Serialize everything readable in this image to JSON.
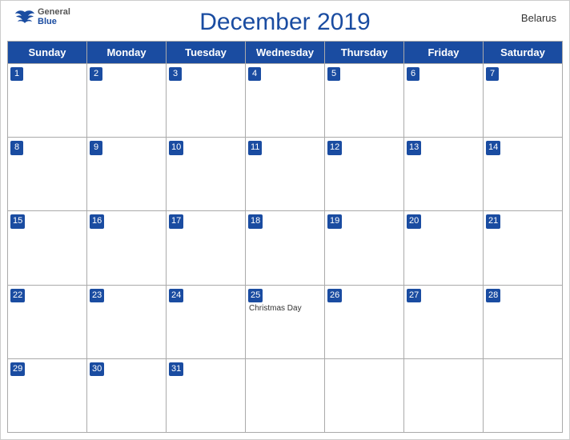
{
  "header": {
    "title": "December 2019",
    "country": "Belarus",
    "logo": {
      "line1": "General",
      "line2": "Blue"
    }
  },
  "days_of_week": [
    "Sunday",
    "Monday",
    "Tuesday",
    "Wednesday",
    "Thursday",
    "Friday",
    "Saturday"
  ],
  "weeks": [
    [
      {
        "num": "1",
        "event": ""
      },
      {
        "num": "2",
        "event": ""
      },
      {
        "num": "3",
        "event": ""
      },
      {
        "num": "4",
        "event": ""
      },
      {
        "num": "5",
        "event": ""
      },
      {
        "num": "6",
        "event": ""
      },
      {
        "num": "7",
        "event": ""
      }
    ],
    [
      {
        "num": "8",
        "event": ""
      },
      {
        "num": "9",
        "event": ""
      },
      {
        "num": "10",
        "event": ""
      },
      {
        "num": "11",
        "event": ""
      },
      {
        "num": "12",
        "event": ""
      },
      {
        "num": "13",
        "event": ""
      },
      {
        "num": "14",
        "event": ""
      }
    ],
    [
      {
        "num": "15",
        "event": ""
      },
      {
        "num": "16",
        "event": ""
      },
      {
        "num": "17",
        "event": ""
      },
      {
        "num": "18",
        "event": ""
      },
      {
        "num": "19",
        "event": ""
      },
      {
        "num": "20",
        "event": ""
      },
      {
        "num": "21",
        "event": ""
      }
    ],
    [
      {
        "num": "22",
        "event": ""
      },
      {
        "num": "23",
        "event": ""
      },
      {
        "num": "24",
        "event": ""
      },
      {
        "num": "25",
        "event": "Christmas Day"
      },
      {
        "num": "26",
        "event": ""
      },
      {
        "num": "27",
        "event": ""
      },
      {
        "num": "28",
        "event": ""
      }
    ],
    [
      {
        "num": "29",
        "event": ""
      },
      {
        "num": "30",
        "event": ""
      },
      {
        "num": "31",
        "event": ""
      },
      {
        "num": "",
        "event": ""
      },
      {
        "num": "",
        "event": ""
      },
      {
        "num": "",
        "event": ""
      },
      {
        "num": "",
        "event": ""
      }
    ]
  ]
}
